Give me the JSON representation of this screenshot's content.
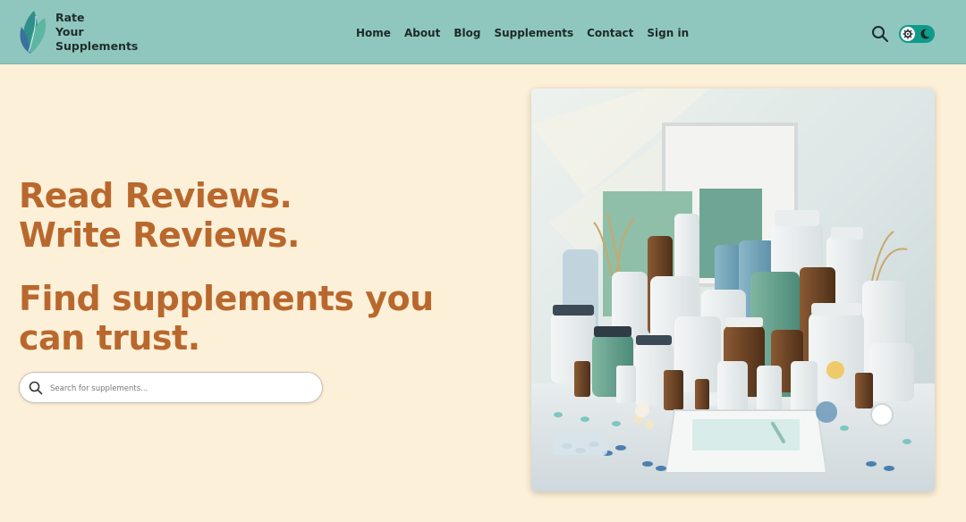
{
  "brand": {
    "name_line1": "Rate",
    "name_line2": "Your",
    "name_line3": "Supplements"
  },
  "nav": {
    "items": [
      {
        "label": "Home"
      },
      {
        "label": "About"
      },
      {
        "label": "Blog"
      },
      {
        "label": "Supplements"
      },
      {
        "label": "Contact"
      },
      {
        "label": "Sign in"
      }
    ]
  },
  "header": {
    "search_icon": "search-icon",
    "theme_toggle_icons": [
      "gear-icon",
      "moon-icon"
    ]
  },
  "hero": {
    "line1": "Read Reviews.",
    "line2": "Write Reviews.",
    "line3": "Find supplements you",
    "line4": "can trust.",
    "search_placeholder": "Search for supplements..."
  },
  "colors": {
    "header_bg": "#8fc7bf",
    "page_bg": "#fdf0d8",
    "accent": "#b9682d",
    "toggle": "#0f9a8a"
  }
}
